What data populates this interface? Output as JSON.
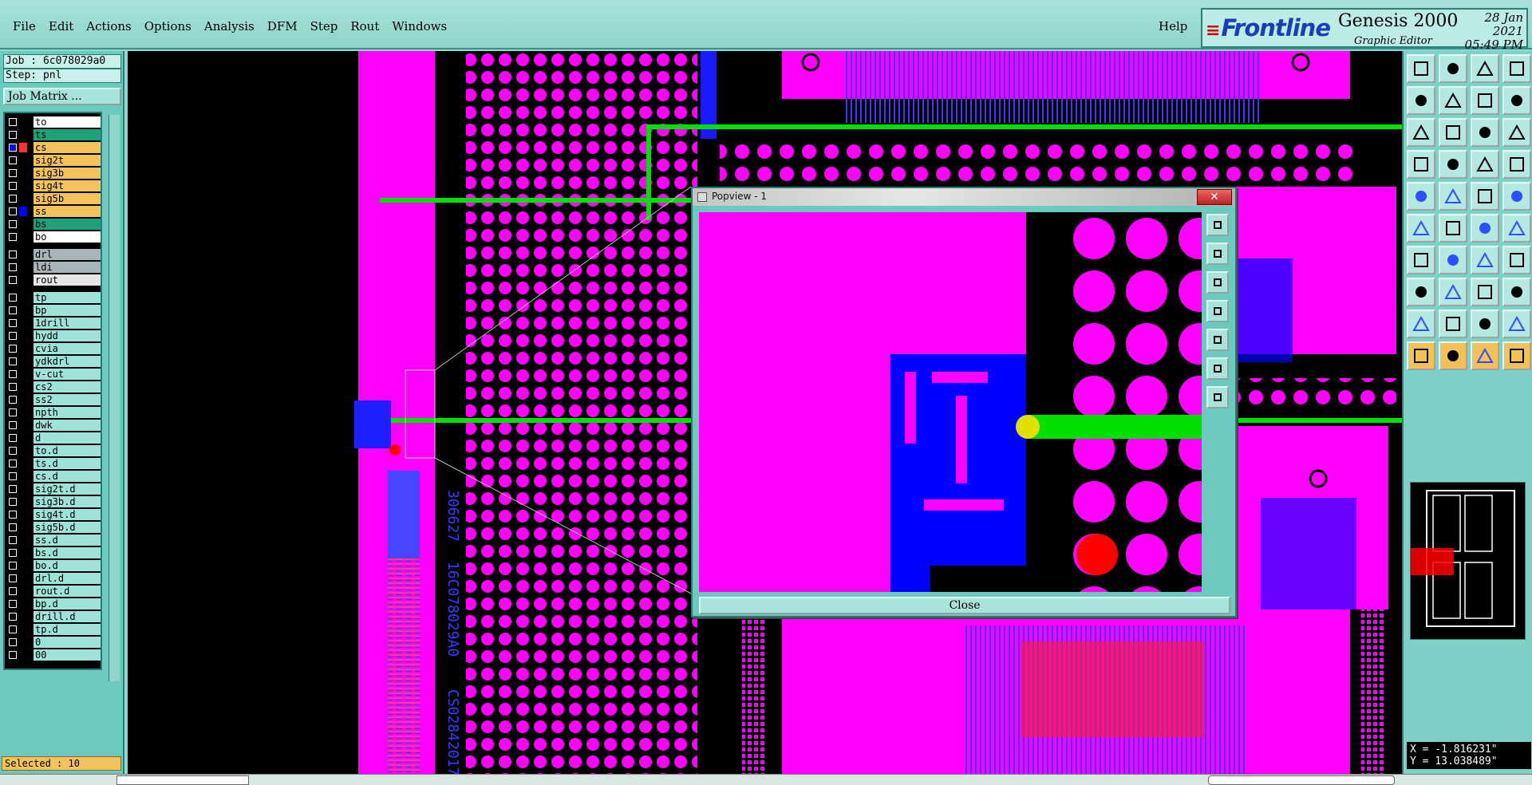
{
  "menu": {
    "file": "File",
    "edit": "Edit",
    "actions": "Actions",
    "options": "Options",
    "analysis": "Analysis",
    "dfm": "DFM",
    "step": "Step",
    "rout": "Rout",
    "windows": "Windows",
    "help": "Help"
  },
  "brand": {
    "logo": "Frontline",
    "product": "Genesis 2000",
    "subtitle": "Graphic Editor",
    "date": "28 Jan 2021",
    "time": "05:49 PM"
  },
  "job": {
    "job_line": "Job : 6c078029a0",
    "step_line": "Step: pnl",
    "matrix_button": "Job Matrix ..."
  },
  "layers": [
    {
      "name": "to",
      "color": "#ffffff"
    },
    {
      "name": "ts",
      "color": "#1fa07a"
    },
    {
      "name": "cs",
      "color": "#f2c25c",
      "active": true
    },
    {
      "name": "sig2t",
      "color": "#f2c25c"
    },
    {
      "name": "sig3b",
      "color": "#f2c25c"
    },
    {
      "name": "sig4t",
      "color": "#f2c25c"
    },
    {
      "name": "sig5b",
      "color": "#f2c25c"
    },
    {
      "name": "ss",
      "color": "#f2c25c"
    },
    {
      "name": "bs",
      "color": "#1fa07a"
    },
    {
      "name": "bo",
      "color": "#ffffff"
    },
    {
      "name": "drl",
      "color": "#a8b4b8"
    },
    {
      "name": "ldi",
      "color": "#a8b4b8"
    },
    {
      "name": "rout",
      "color": "#e6e6e6"
    },
    {
      "name": "tp",
      "color": "#9fe2da"
    },
    {
      "name": "bp",
      "color": "#9fe2da"
    },
    {
      "name": "1drill",
      "color": "#9fe2da"
    },
    {
      "name": "hydd",
      "color": "#9fe2da"
    },
    {
      "name": "cvia",
      "color": "#9fe2da"
    },
    {
      "name": "ydkdrl",
      "color": "#9fe2da"
    },
    {
      "name": "v-cut",
      "color": "#9fe2da"
    },
    {
      "name": "cs2",
      "color": "#9fe2da"
    },
    {
      "name": "ss2",
      "color": "#9fe2da"
    },
    {
      "name": "npth",
      "color": "#9fe2da"
    },
    {
      "name": "dwk",
      "color": "#9fe2da"
    },
    {
      "name": "d",
      "color": "#9fe2da"
    },
    {
      "name": "to.d",
      "color": "#9fe2da"
    },
    {
      "name": "ts.d",
      "color": "#9fe2da"
    },
    {
      "name": "cs.d",
      "color": "#9fe2da"
    },
    {
      "name": "sig2t.d",
      "color": "#9fe2da"
    },
    {
      "name": "sig3b.d",
      "color": "#9fe2da"
    },
    {
      "name": "sig4t.d",
      "color": "#9fe2da"
    },
    {
      "name": "sig5b.d",
      "color": "#9fe2da"
    },
    {
      "name": "ss.d",
      "color": "#9fe2da"
    },
    {
      "name": "bs.d",
      "color": "#9fe2da"
    },
    {
      "name": "bo.d",
      "color": "#9fe2da"
    },
    {
      "name": "drl.d",
      "color": "#9fe2da"
    },
    {
      "name": "rout.d",
      "color": "#9fe2da"
    },
    {
      "name": "bp.d",
      "color": "#9fe2da"
    },
    {
      "name": "drill.d",
      "color": "#9fe2da"
    },
    {
      "name": "tp.d",
      "color": "#9fe2da"
    },
    {
      "name": "0",
      "color": "#9fe2da"
    },
    {
      "name": "00",
      "color": "#9fe2da"
    }
  ],
  "status": {
    "selected": "Selected : 10"
  },
  "popview": {
    "title": "Popview - 1",
    "close_label": "Close",
    "x_label": "✕"
  },
  "coords": {
    "x": "X = -1.816231\"",
    "y": "Y = 13.038489\""
  },
  "colors": {
    "copper": "#ff00ff",
    "trace_blue": "#0000ff",
    "highlight_green": "#00e000",
    "pad_red": "#ff0000",
    "panel_teal": "#7fd0c6",
    "accent_orange": "#f2c25c"
  },
  "canvas_text": {
    "board_id_1": "306627",
    "board_id_2": "16C078029A0",
    "board_id_3": "CS02842017"
  },
  "tools": [
    "home-up-icon",
    "zoom-window-icon",
    "home-icon",
    "redraw-icon",
    "pan-left-icon",
    "pan-right-icon",
    "flip-icon",
    "mirror-icon",
    "fit-icon",
    "center-icon",
    "scale-icon",
    "help-icon",
    "measure-icon",
    "grid-icon",
    "snap-icon",
    "snap-alt-icon",
    "pad-icon",
    "line-icon",
    "rect-icon",
    "circle-icon",
    "node-icon",
    "cross-icon",
    "edge-icon",
    "arc-icon",
    "draw-line-icon",
    "draw-diag-icon",
    "draw-arc-icon",
    "cross-flags-icon",
    "add-pad-icon",
    "dash-icon",
    "box-icon",
    "array-icon",
    "triangle-icon",
    "text-a-icon",
    "text-outline-icon",
    "text-fill-icon",
    "select-arrow-icon",
    "select-box-icon",
    "select-poly-icon",
    "select-multi-icon"
  ]
}
